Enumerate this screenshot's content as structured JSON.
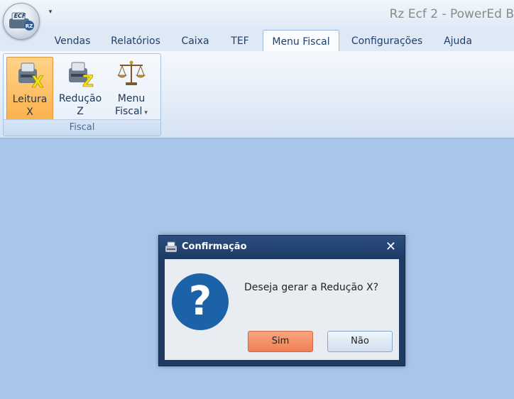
{
  "window": {
    "title": "Rz Ecf 2 - PowerEd B",
    "app_logo_text": "ECF",
    "app_logo_sub": "RZ",
    "quick_access_glyph": "▾"
  },
  "tabs": [
    {
      "label": "Vendas"
    },
    {
      "label": "Relatórios"
    },
    {
      "label": "Caixa"
    },
    {
      "label": "TEF"
    },
    {
      "label": "Menu Fiscal",
      "active": true
    },
    {
      "label": "Configurações"
    },
    {
      "label": "Ajuda"
    }
  ],
  "ribbon": {
    "group_label": "Fiscal",
    "buttons": [
      {
        "line1": "Leitura",
        "line2": "X",
        "icon": "printer-x-icon"
      },
      {
        "line1": "Redução",
        "line2": "Z",
        "icon": "printer-z-icon"
      },
      {
        "line1": "Menu",
        "line2": "Fiscal",
        "icon": "scales-icon",
        "dropdown_glyph": "▾"
      }
    ]
  },
  "dialog": {
    "title": "Confirmação",
    "close_glyph": "✕",
    "icon_glyph": "?",
    "message": "Deseja gerar a Redução X?",
    "yes_label": "Sim",
    "no_label": "Não"
  },
  "colors": {
    "workspace": "#a9c5ea",
    "dialog_frame": "#1f3b63",
    "question_icon": "#1b62a9",
    "hot_button": "#fbb14e"
  }
}
